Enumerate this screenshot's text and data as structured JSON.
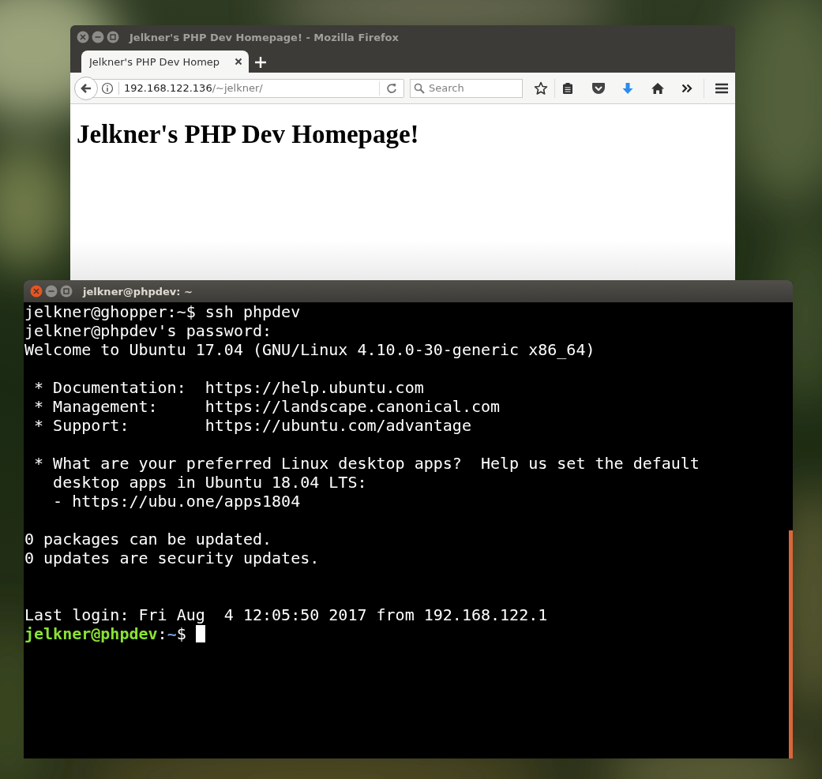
{
  "browser": {
    "title": "Jelkner's PHP Dev Homepage! - Mozilla Firefox",
    "focused": false,
    "tabs": [
      {
        "label": "Jelkner's PHP Dev Homep",
        "selected": true
      }
    ],
    "url": {
      "host": "192.168.122.136",
      "path": "/~jelkner/"
    },
    "search": {
      "placeholder": "Search"
    },
    "page": {
      "heading": "Jelkner's PHP Dev Homepage!"
    }
  },
  "terminal": {
    "title": "jelkner@phpdev: ~",
    "focused": true,
    "blocks": [
      {
        "kind": "text",
        "lines": [
          "jelkner@ghopper:~$ ssh phpdev",
          "jelkner@phpdev's password:",
          "Welcome to Ubuntu 17.04 (GNU/Linux 4.10.0-30-generic x86_64)"
        ]
      },
      {
        "kind": "text",
        "lines": [
          " * Documentation:  https://help.ubuntu.com",
          " * Management:     https://landscape.canonical.com",
          " * Support:        https://ubuntu.com/advantage"
        ]
      },
      {
        "kind": "text",
        "lines": [
          " * What are your preferred Linux desktop apps?  Help us set the default",
          "   desktop apps in Ubuntu 18.04 LTS:",
          "   - https://ubu.one/apps1804"
        ]
      },
      {
        "kind": "text",
        "lines": [
          "0 packages can be updated.",
          "0 updates are security updates."
        ]
      },
      {
        "kind": "wide-gap",
        "lines": [
          "Last login: Fri Aug  4 12:05:50 2017 from 192.168.122.1"
        ]
      }
    ],
    "prompt": {
      "user_host": "jelkner@phpdev",
      "separator": ":",
      "path": "~",
      "symbol": "$"
    }
  }
}
